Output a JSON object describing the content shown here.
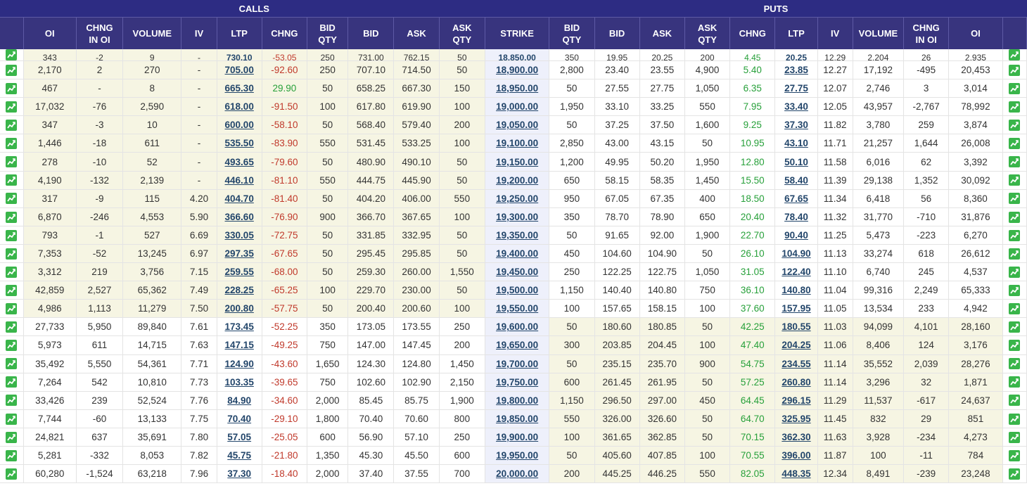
{
  "group_headers": {
    "calls": "CALLS",
    "puts": "PUTS"
  },
  "columns": {
    "calls": [
      "OI",
      "CHNG\nIN OI",
      "VOLUME",
      "IV",
      "LTP",
      "CHNG",
      "BID\nQTY",
      "BID",
      "ASK",
      "ASK\nQTY"
    ],
    "strike": "STRIKE",
    "puts": [
      "BID\nQTY",
      "BID",
      "ASK",
      "ASK\nQTY",
      "CHNG",
      "LTP",
      "IV",
      "VOLUME",
      "CHNG\nIN OI",
      "OI"
    ]
  },
  "icon": "chart-up-icon",
  "colors": {
    "header_bg": "#38347e",
    "itm_bg": "#f6f5e3",
    "negative": "#c0392b",
    "positive": "#27a03a",
    "icon": "#39b54a"
  },
  "rows": [
    {
      "calls": [
        "343",
        "-2",
        "9",
        "-",
        "730.10",
        "-53.05",
        "250",
        "731.00",
        "762.15",
        "50"
      ],
      "strike": "18,850.00",
      "puts": [
        "350",
        "19.95",
        "20.25",
        "200",
        "4.45",
        "20.25",
        "12.29",
        "2,204",
        "26",
        "2,935"
      ],
      "call_itm": true,
      "put_itm": false
    },
    {
      "calls": [
        "2,170",
        "2",
        "270",
        "-",
        "705.00",
        "-92.60",
        "250",
        "707.10",
        "714.50",
        "50"
      ],
      "strike": "18,900.00",
      "puts": [
        "2,800",
        "23.40",
        "23.55",
        "4,900",
        "5.40",
        "23.85",
        "12.27",
        "17,192",
        "-495",
        "20,453"
      ],
      "call_itm": true,
      "put_itm": false
    },
    {
      "calls": [
        "467",
        "-",
        "8",
        "-",
        "665.30",
        "29.90",
        "50",
        "658.25",
        "667.30",
        "150"
      ],
      "strike": "18,950.00",
      "puts": [
        "50",
        "27.55",
        "27.75",
        "1,050",
        "6.35",
        "27.75",
        "12.07",
        "2,746",
        "3",
        "3,014"
      ],
      "call_itm": true,
      "put_itm": false
    },
    {
      "calls": [
        "17,032",
        "-76",
        "2,590",
        "-",
        "618.00",
        "-91.50",
        "100",
        "617.80",
        "619.90",
        "100"
      ],
      "strike": "19,000.00",
      "puts": [
        "1,950",
        "33.10",
        "33.25",
        "550",
        "7.95",
        "33.40",
        "12.05",
        "43,957",
        "-2,767",
        "78,992"
      ],
      "call_itm": true,
      "put_itm": false
    },
    {
      "calls": [
        "347",
        "-3",
        "10",
        "-",
        "600.00",
        "-58.10",
        "50",
        "568.40",
        "579.40",
        "200"
      ],
      "strike": "19,050.00",
      "puts": [
        "50",
        "37.25",
        "37.50",
        "1,600",
        "9.25",
        "37.30",
        "11.82",
        "3,780",
        "259",
        "3,874"
      ],
      "call_itm": true,
      "put_itm": false
    },
    {
      "calls": [
        "1,446",
        "-18",
        "611",
        "-",
        "535.50",
        "-83.90",
        "550",
        "531.45",
        "533.25",
        "100"
      ],
      "strike": "19,100.00",
      "puts": [
        "2,850",
        "43.00",
        "43.15",
        "50",
        "10.95",
        "43.10",
        "11.71",
        "21,257",
        "1,644",
        "26,008"
      ],
      "call_itm": true,
      "put_itm": false
    },
    {
      "calls": [
        "278",
        "-10",
        "52",
        "-",
        "493.65",
        "-79.60",
        "50",
        "480.90",
        "490.10",
        "50"
      ],
      "strike": "19,150.00",
      "puts": [
        "1,200",
        "49.95",
        "50.20",
        "1,950",
        "12.80",
        "50.10",
        "11.58",
        "6,016",
        "62",
        "3,392"
      ],
      "call_itm": true,
      "put_itm": false
    },
    {
      "calls": [
        "4,190",
        "-132",
        "2,139",
        "-",
        "446.10",
        "-81.10",
        "550",
        "444.75",
        "445.90",
        "50"
      ],
      "strike": "19,200.00",
      "puts": [
        "650",
        "58.15",
        "58.35",
        "1,450",
        "15.50",
        "58.40",
        "11.39",
        "29,138",
        "1,352",
        "30,092"
      ],
      "call_itm": true,
      "put_itm": false
    },
    {
      "calls": [
        "317",
        "-9",
        "115",
        "4.20",
        "404.70",
        "-81.40",
        "50",
        "404.20",
        "406.00",
        "550"
      ],
      "strike": "19,250.00",
      "puts": [
        "950",
        "67.05",
        "67.35",
        "400",
        "18.50",
        "67.65",
        "11.34",
        "6,418",
        "56",
        "8,360"
      ],
      "call_itm": true,
      "put_itm": false
    },
    {
      "calls": [
        "6,870",
        "-246",
        "4,553",
        "5.90",
        "366.60",
        "-76.90",
        "900",
        "366.70",
        "367.65",
        "100"
      ],
      "strike": "19,300.00",
      "puts": [
        "350",
        "78.70",
        "78.90",
        "650",
        "20.40",
        "78.40",
        "11.32",
        "31,770",
        "-710",
        "31,876"
      ],
      "call_itm": true,
      "put_itm": false
    },
    {
      "calls": [
        "793",
        "-1",
        "527",
        "6.69",
        "330.05",
        "-72.75",
        "50",
        "331.85",
        "332.95",
        "50"
      ],
      "strike": "19,350.00",
      "puts": [
        "50",
        "91.65",
        "92.00",
        "1,900",
        "22.70",
        "90.40",
        "11.25",
        "5,473",
        "-223",
        "6,270"
      ],
      "call_itm": true,
      "put_itm": false
    },
    {
      "calls": [
        "7,353",
        "-52",
        "13,245",
        "6.97",
        "297.35",
        "-67.65",
        "50",
        "295.45",
        "295.85",
        "50"
      ],
      "strike": "19,400.00",
      "puts": [
        "450",
        "104.60",
        "104.90",
        "50",
        "26.10",
        "104.90",
        "11.13",
        "33,274",
        "618",
        "26,612"
      ],
      "call_itm": true,
      "put_itm": false
    },
    {
      "calls": [
        "3,312",
        "219",
        "3,756",
        "7.15",
        "259.55",
        "-68.00",
        "50",
        "259.30",
        "260.00",
        "1,550"
      ],
      "strike": "19,450.00",
      "puts": [
        "250",
        "122.25",
        "122.75",
        "1,050",
        "31.05",
        "122.40",
        "11.10",
        "6,740",
        "245",
        "4,537"
      ],
      "call_itm": true,
      "put_itm": false
    },
    {
      "calls": [
        "42,859",
        "2,527",
        "65,362",
        "7.49",
        "228.25",
        "-65.25",
        "100",
        "229.70",
        "230.00",
        "50"
      ],
      "strike": "19,500.00",
      "puts": [
        "1,150",
        "140.40",
        "140.80",
        "750",
        "36.10",
        "140.80",
        "11.04",
        "99,316",
        "2,249",
        "65,333"
      ],
      "call_itm": true,
      "put_itm": false
    },
    {
      "calls": [
        "4,986",
        "1,113",
        "11,279",
        "7.50",
        "200.80",
        "-57.75",
        "50",
        "200.40",
        "200.60",
        "100"
      ],
      "strike": "19,550.00",
      "puts": [
        "100",
        "157.65",
        "158.15",
        "100",
        "37.60",
        "157.95",
        "11.05",
        "13,534",
        "233",
        "4,942"
      ],
      "call_itm": true,
      "put_itm": false
    },
    {
      "calls": [
        "27,733",
        "5,950",
        "89,840",
        "7.61",
        "173.45",
        "-52.25",
        "350",
        "173.05",
        "173.55",
        "250"
      ],
      "strike": "19,600.00",
      "puts": [
        "50",
        "180.60",
        "180.85",
        "50",
        "42.25",
        "180.55",
        "11.03",
        "94,099",
        "4,101",
        "28,160"
      ],
      "call_itm": false,
      "put_itm": true
    },
    {
      "calls": [
        "5,973",
        "611",
        "14,715",
        "7.63",
        "147.15",
        "-49.25",
        "750",
        "147.00",
        "147.45",
        "200"
      ],
      "strike": "19,650.00",
      "puts": [
        "300",
        "203.85",
        "204.45",
        "100",
        "47.40",
        "204.25",
        "11.06",
        "8,406",
        "124",
        "3,176"
      ],
      "call_itm": false,
      "put_itm": true
    },
    {
      "calls": [
        "35,492",
        "5,550",
        "54,361",
        "7.71",
        "124.90",
        "-43.60",
        "1,650",
        "124.30",
        "124.80",
        "1,450"
      ],
      "strike": "19,700.00",
      "puts": [
        "50",
        "235.15",
        "235.70",
        "900",
        "54.75",
        "234.55",
        "11.14",
        "35,552",
        "2,039",
        "28,276"
      ],
      "call_itm": false,
      "put_itm": true
    },
    {
      "calls": [
        "7,264",
        "542",
        "10,810",
        "7.73",
        "103.35",
        "-39.65",
        "750",
        "102.60",
        "102.90",
        "2,150"
      ],
      "strike": "19,750.00",
      "puts": [
        "600",
        "261.45",
        "261.95",
        "50",
        "57.25",
        "260.80",
        "11.14",
        "3,296",
        "32",
        "1,871"
      ],
      "call_itm": false,
      "put_itm": true
    },
    {
      "calls": [
        "33,426",
        "239",
        "52,524",
        "7.76",
        "84.90",
        "-34.60",
        "2,000",
        "85.45",
        "85.75",
        "1,900"
      ],
      "strike": "19,800.00",
      "puts": [
        "1,150",
        "296.50",
        "297.00",
        "450",
        "64.45",
        "296.15",
        "11.29",
        "11,537",
        "-617",
        "24,637"
      ],
      "call_itm": false,
      "put_itm": true
    },
    {
      "calls": [
        "7,744",
        "-60",
        "13,133",
        "7.75",
        "70.40",
        "-29.10",
        "1,800",
        "70.40",
        "70.60",
        "800"
      ],
      "strike": "19,850.00",
      "puts": [
        "550",
        "326.00",
        "326.60",
        "50",
        "64.70",
        "325.95",
        "11.45",
        "832",
        "29",
        "851"
      ],
      "call_itm": false,
      "put_itm": true
    },
    {
      "calls": [
        "24,821",
        "637",
        "35,691",
        "7.80",
        "57.05",
        "-25.05",
        "600",
        "56.90",
        "57.10",
        "250"
      ],
      "strike": "19,900.00",
      "puts": [
        "100",
        "361.65",
        "362.85",
        "50",
        "70.15",
        "362.30",
        "11.63",
        "3,928",
        "-234",
        "4,273"
      ],
      "call_itm": false,
      "put_itm": true
    },
    {
      "calls": [
        "5,281",
        "-332",
        "8,053",
        "7.82",
        "45.75",
        "-21.80",
        "1,350",
        "45.30",
        "45.50",
        "600"
      ],
      "strike": "19,950.00",
      "puts": [
        "50",
        "405.60",
        "407.85",
        "100",
        "70.55",
        "396.00",
        "11.87",
        "100",
        "-11",
        "784"
      ],
      "call_itm": false,
      "put_itm": true
    },
    {
      "calls": [
        "60,280",
        "-1,524",
        "63,218",
        "7.96",
        "37.30",
        "-18.40",
        "2,000",
        "37.40",
        "37.55",
        "700"
      ],
      "strike": "20,000.00",
      "puts": [
        "200",
        "445.25",
        "446.25",
        "550",
        "82.05",
        "448.35",
        "12.34",
        "8,491",
        "-239",
        "23,248"
      ],
      "call_itm": false,
      "put_itm": true
    }
  ]
}
